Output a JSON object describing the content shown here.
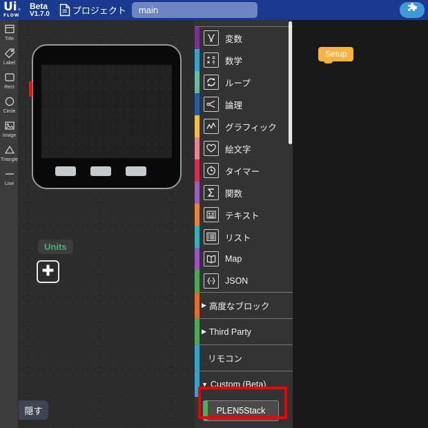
{
  "header": {
    "logo_primary": "Ui",
    "logo_secondary": "FLOW",
    "beta_label": "Beta",
    "version": "V1.7.0",
    "project_label": "プロジェクト",
    "project_icon": "document-icon",
    "tab_value": "main",
    "extension_icon": "puzzle-piece-icon",
    "background_color": "#1a3a8f",
    "tab_color": "#6d85c4",
    "extension_button_color": "#3e9ad8"
  },
  "tools": {
    "items": [
      {
        "label": "Title",
        "icon": "title-icon"
      },
      {
        "label": "Label",
        "icon": "label-tag-icon"
      },
      {
        "label": "Rect",
        "icon": "rectangle-icon"
      },
      {
        "label": "Circle",
        "icon": "circle-icon"
      },
      {
        "label": "Image",
        "icon": "image-icon"
      },
      {
        "label": "Triangle",
        "icon": "triangle-icon"
      },
      {
        "label": "Line",
        "icon": "line-icon"
      }
    ]
  },
  "device": {
    "name": "m5stack-device-preview",
    "buttons": [
      "button-a",
      "button-b",
      "button-c"
    ],
    "led_color": "#e01818",
    "units_label": "Units",
    "units_label_color": "#4caf76",
    "add_unit_icon": "plus-icon",
    "hide_button_label": "隠す"
  },
  "palette": {
    "blocks": [
      {
        "label": "変数",
        "icon": "variable-icon",
        "color": "#7b2f96"
      },
      {
        "label": "数学",
        "icon": "math-icon",
        "color": "#29a8d8"
      },
      {
        "label": "ループ",
        "icon": "loop-icon",
        "color": "#5fc0a4"
      },
      {
        "label": "論理",
        "icon": "logic-icon",
        "color": "#1b5fad"
      },
      {
        "label": "グラフィック",
        "icon": "graphic-icon",
        "color": "#f5c133"
      },
      {
        "label": "絵文字",
        "icon": "emoji-heart-icon",
        "color": "#f07f8d"
      },
      {
        "label": "タイマー",
        "icon": "timer-clock-icon",
        "color": "#e8254f"
      },
      {
        "label": "関数",
        "icon": "function-sigma-icon",
        "color": "#a15bc0"
      },
      {
        "label": "テキスト",
        "icon": "text-icon",
        "color": "#ef8133"
      },
      {
        "label": "リスト",
        "icon": "list-icon",
        "color": "#2bb5bf"
      },
      {
        "label": "Map",
        "icon": "map-book-icon",
        "color": "#a14fc6"
      },
      {
        "label": "JSON",
        "icon": "json-braces-icon",
        "color": "#46ae4c"
      }
    ],
    "groups": [
      {
        "label": "高度なブロック",
        "arrow": "▶",
        "color": "#ea6a1e",
        "expanded": false
      },
      {
        "label": "Third Party",
        "arrow": "▶",
        "color": "#46ae4c",
        "expanded": false
      }
    ],
    "plain": {
      "label": "リモコン",
      "color": "#29a8d8"
    },
    "custom_group": {
      "label": "Custom (Beta)",
      "arrow": "▼",
      "color": "#29a8d8",
      "expanded": true,
      "children": [
        {
          "label": "PLEN5Stack",
          "color": "#4caf50",
          "highlighted": true
        }
      ]
    },
    "highlight_color": "#ef0000"
  },
  "canvas": {
    "setup_block_label": "Setup",
    "setup_block_color": "#f7b141",
    "background_color": "#191919"
  }
}
